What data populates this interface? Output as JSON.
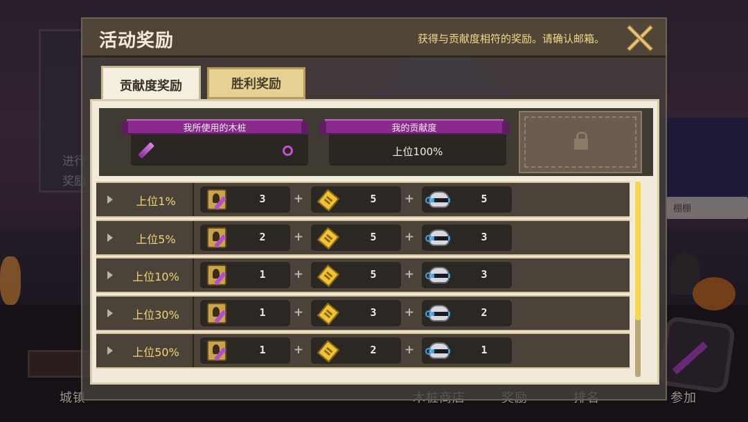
{
  "background": {
    "side_text_1": "进行",
    "side_text_2": "奖励",
    "right_chip": "棚棚",
    "bottom_nav": {
      "town": "城镇",
      "shop": "木桩商店",
      "reward": "奖励",
      "rank": "排名",
      "join": "参加"
    }
  },
  "dialog": {
    "title": "活动奖励",
    "note": "获得与贡献度相符的奖励。请确认邮箱。",
    "close_icon": "close-x-icon",
    "tabs": [
      {
        "label": "贡献度奖励",
        "active": true
      },
      {
        "label": "胜利奖励",
        "active": false
      }
    ],
    "info": {
      "stake_label": "我所使用的木桩",
      "contribution_label": "我的贡献度",
      "contribution_value": "上位100%",
      "lock_icon": "lock-icon"
    },
    "rows": [
      {
        "rank": "上位1%",
        "items": [
          {
            "icon": "scroll-icon",
            "count": "3"
          },
          {
            "icon": "ticket-icon",
            "count": "5"
          },
          {
            "icon": "robot-head-icon",
            "count": "5"
          }
        ]
      },
      {
        "rank": "上位5%",
        "items": [
          {
            "icon": "scroll-icon",
            "count": "2"
          },
          {
            "icon": "ticket-icon",
            "count": "5"
          },
          {
            "icon": "robot-head-icon",
            "count": "3"
          }
        ]
      },
      {
        "rank": "上位10%",
        "items": [
          {
            "icon": "scroll-icon",
            "count": "1"
          },
          {
            "icon": "ticket-icon",
            "count": "5"
          },
          {
            "icon": "robot-head-icon",
            "count": "3"
          }
        ]
      },
      {
        "rank": "上位30%",
        "items": [
          {
            "icon": "scroll-icon",
            "count": "1"
          },
          {
            "icon": "ticket-icon",
            "count": "3"
          },
          {
            "icon": "robot-head-icon",
            "count": "2"
          }
        ]
      },
      {
        "rank": "上位50%",
        "items": [
          {
            "icon": "scroll-icon",
            "count": "1"
          },
          {
            "icon": "ticket-icon",
            "count": "2"
          },
          {
            "icon": "robot-head-icon",
            "count": "1"
          }
        ]
      }
    ],
    "plus_sign": "+"
  },
  "colors": {
    "ribbon": "#8a2a8c",
    "rank_text": "#f0d475",
    "note_text": "#f3d98a",
    "scroll_thumb": "#f5d84a"
  }
}
